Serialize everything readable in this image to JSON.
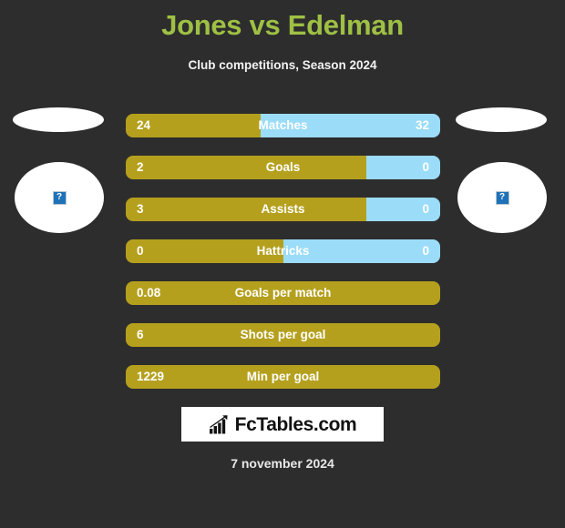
{
  "header": {
    "title": "Jones vs Edelman",
    "subtitle": "Club competitions, Season 2024",
    "title_color": "#9ec044"
  },
  "players": {
    "left": {
      "avatar_placeholder": "broken-image-icon",
      "placeholder_glyph": "?"
    },
    "right": {
      "avatar_placeholder": "broken-image-icon",
      "placeholder_glyph": "?"
    }
  },
  "colors": {
    "background": "#2d2d2d",
    "home_bar": "#b5a01e",
    "away_bar": "#9bdcf8",
    "text": "#ffffff",
    "accent": "#9ec044"
  },
  "chart_data": {
    "type": "bar",
    "title": "Jones vs Edelman",
    "subtitle": "Club competitions, Season 2024",
    "orientation": "horizontal-diverging",
    "series": [
      {
        "name": "Jones",
        "color": "#b5a01e"
      },
      {
        "name": "Edelman",
        "color": "#9bdcf8"
      }
    ],
    "categories": [
      "Matches",
      "Goals",
      "Assists",
      "Hattricks",
      "Goals per match",
      "Shots per goal",
      "Min per goal"
    ],
    "rows": [
      {
        "label": "Matches",
        "left_value": "24",
        "right_value": "32",
        "left_pct": 42.9,
        "dual": true
      },
      {
        "label": "Goals",
        "left_value": "2",
        "right_value": "0",
        "left_pct": 76.5,
        "dual": true
      },
      {
        "label": "Assists",
        "left_value": "3",
        "right_value": "0",
        "left_pct": 76.5,
        "dual": true
      },
      {
        "label": "Hattricks",
        "left_value": "0",
        "right_value": "0",
        "left_pct": 50.0,
        "dual": true
      },
      {
        "label": "Goals per match",
        "left_value": "0.08",
        "right_value": "",
        "left_pct": 100,
        "dual": false
      },
      {
        "label": "Shots per goal",
        "left_value": "6",
        "right_value": "",
        "left_pct": 100,
        "dual": false
      },
      {
        "label": "Min per goal",
        "left_value": "1229",
        "right_value": "",
        "left_pct": 100,
        "dual": false
      }
    ]
  },
  "footer": {
    "logo_text": "FcTables.com",
    "logo_icon": "bar-chart-growth-icon",
    "date": "7 november 2024"
  }
}
